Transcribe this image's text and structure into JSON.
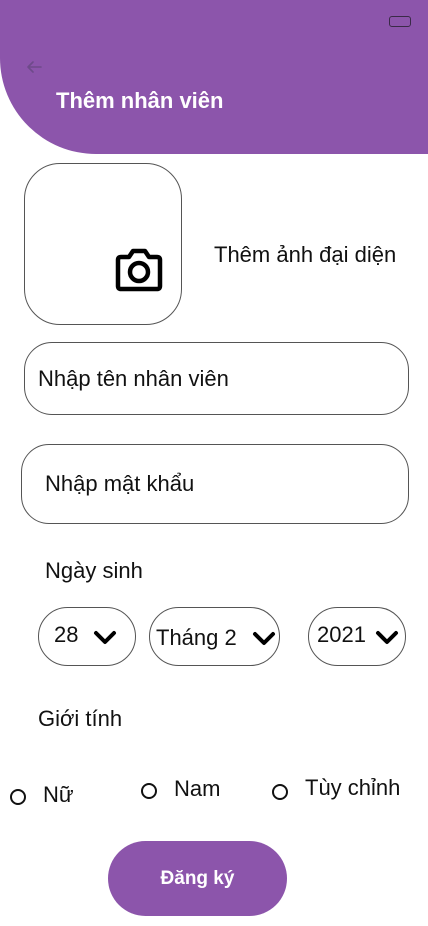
{
  "header": {
    "title": "Thêm nhân viên",
    "back_icon": "arrow-left-icon",
    "accent_color": "#8c55ab"
  },
  "avatar": {
    "label": "Thêm ảnh đại diện",
    "icon": "camera-icon"
  },
  "form": {
    "name_placeholder": "Nhập tên nhân viên",
    "password_placeholder": "Nhập mật khẩu",
    "dob": {
      "label": "Ngày sinh",
      "day": "28",
      "month": "Tháng 2",
      "year": "2021",
      "dropdown_icon": "chevron-down-icon"
    },
    "gender": {
      "label": "Giới tính",
      "options": [
        "Nữ",
        "Nam",
        "Tùy chỉnh"
      ]
    },
    "submit_label": "Đăng ký"
  }
}
